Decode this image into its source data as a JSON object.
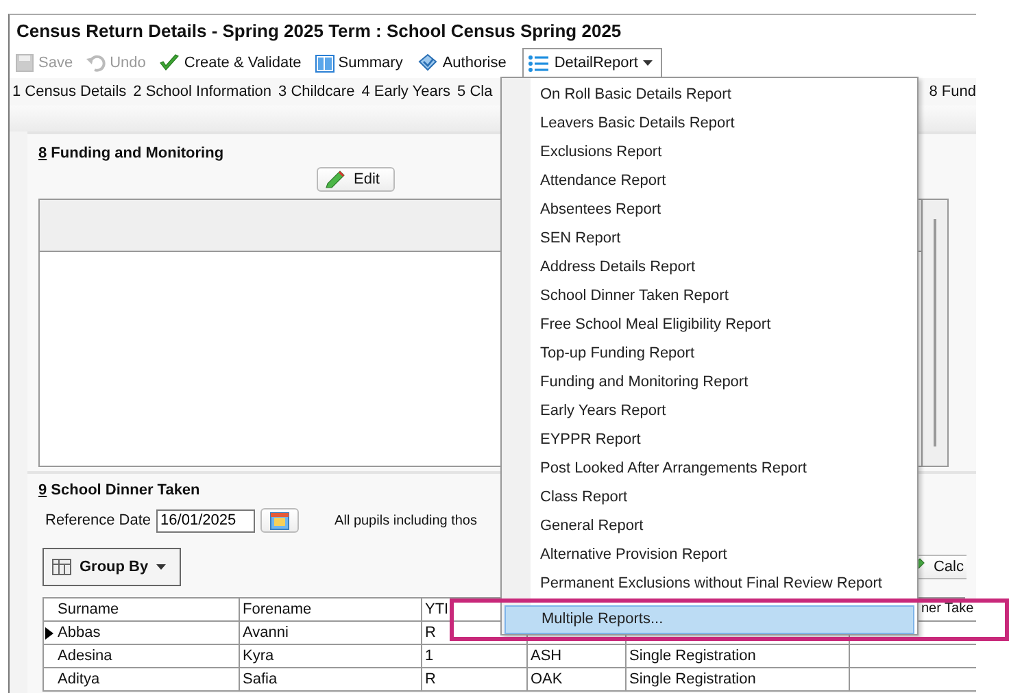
{
  "window": {
    "title": "Census Return Details - Spring 2025 Term : School Census Spring 2025"
  },
  "toolbar": {
    "items": [
      {
        "kind": "save",
        "label": "Save",
        "disabled": true
      },
      {
        "kind": "undo",
        "label": "Undo",
        "disabled": true
      },
      {
        "kind": "validate",
        "label": "Create & Validate",
        "disabled": false
      },
      {
        "kind": "summary",
        "label": "Summary",
        "disabled": false
      },
      {
        "kind": "authorise",
        "label": "Authorise",
        "disabled": false
      }
    ],
    "dropdown": {
      "label": "DetailReport",
      "open": true
    }
  },
  "section_nav": [
    "1 Census Details",
    "2 School Information",
    "3 Childcare",
    "4 Early Years",
    "5 Cla",
    "8 Fund"
  ],
  "funding_section": {
    "number": "8",
    "title": "Funding and Monitoring",
    "edit_button": "Edit"
  },
  "dinner_section": {
    "number": "9",
    "title": "School Dinner Taken",
    "reference_date": {
      "label": "Reference Date",
      "value": "16/01/2025"
    },
    "note": "All pupils including thos",
    "group_by": "Group By",
    "calc_button": "Calc",
    "table": {
      "columns": [
        "Surname",
        "Forename",
        "YTI",
        null,
        null,
        "ner Take"
      ],
      "rows": [
        {
          "selected": true,
          "cells": [
            "Abbas",
            "Avanni",
            "R",
            null,
            null,
            null
          ]
        },
        {
          "selected": false,
          "cells": [
            "Adesina",
            "Kyra",
            "1",
            "ASH",
            "Single Registration",
            null
          ]
        },
        {
          "selected": false,
          "cells": [
            "Aditya",
            "Safia",
            "R",
            "OAK",
            "Single Registration",
            null
          ]
        }
      ]
    }
  },
  "report_menu": {
    "items": [
      {
        "label": "On Roll Basic Details Report",
        "selected": false
      },
      {
        "label": "Leavers Basic Details Report",
        "selected": false
      },
      {
        "label": "Exclusions Report",
        "selected": false
      },
      {
        "label": "Attendance Report",
        "selected": false
      },
      {
        "label": "Absentees Report",
        "selected": false
      },
      {
        "label": "SEN Report",
        "selected": false
      },
      {
        "label": "Address Details Report",
        "selected": false
      },
      {
        "label": "School Dinner Taken Report",
        "selected": false
      },
      {
        "label": "Free School Meal Eligibility Report",
        "selected": false
      },
      {
        "label": "Top-up Funding Report",
        "selected": false
      },
      {
        "label": "Funding and Monitoring Report",
        "selected": false
      },
      {
        "label": "Early Years Report",
        "selected": false
      },
      {
        "label": "EYPPR Report",
        "selected": false
      },
      {
        "label": "Post Looked After Arrangements Report",
        "selected": false
      },
      {
        "label": "Class Report",
        "selected": false
      },
      {
        "label": "General Report",
        "selected": false
      },
      {
        "label": "Alternative Provision Report",
        "selected": false
      },
      {
        "label": "Permanent Exclusions without Final Review Report",
        "selected": false
      }
    ],
    "footer_items": [
      {
        "label": "Multiple Reports...",
        "selected": true
      }
    ]
  }
}
